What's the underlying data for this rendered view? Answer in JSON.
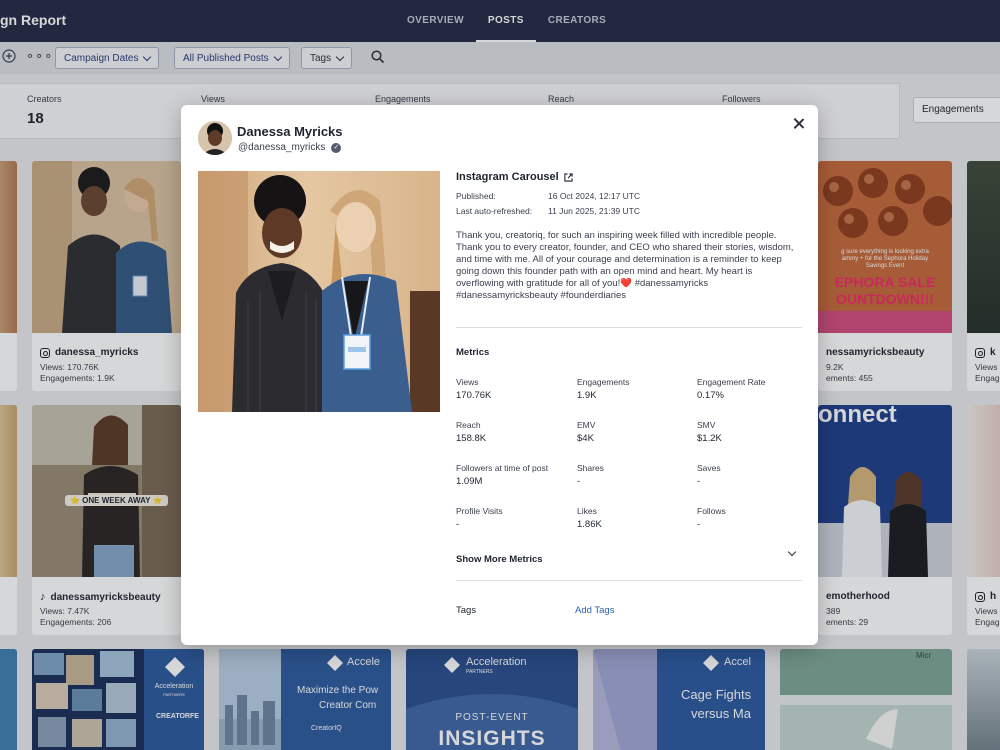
{
  "app": {
    "title": "gn Report"
  },
  "nav": {
    "tabs": [
      {
        "label": "OVERVIEW"
      },
      {
        "label": "POSTS"
      },
      {
        "label": "CREATORS"
      }
    ]
  },
  "filters": {
    "campaign_dates": "Campaign Dates",
    "published_posts": "All Published Posts",
    "tags": "Tags"
  },
  "stats": {
    "creators_label": "Creators",
    "creators_value": "18",
    "views_label": "Views",
    "engagements_label": "Engagements",
    "reach_label": "Reach",
    "followers_label": "Followers",
    "sort_value": "Engagements"
  },
  "cards": [
    {
      "handle": "danessa_myricks",
      "m1": "Views: 170.76K",
      "m2": "Engagements: 1.9K"
    },
    {
      "handle": "danessamyricksbeauty",
      "m1": "Views: 7.47K",
      "m2": "Engagements: 206"
    },
    {
      "handle": "nessamyricksbeauty",
      "m1": "9.2K",
      "m2": "ements: 455"
    },
    {
      "handle": "emotherhood",
      "m1": "389",
      "m2": "ements: 29"
    },
    {
      "handle": "k",
      "m1": "Views",
      "m2": "Engag"
    },
    {
      "handle": "h",
      "m1": "Views",
      "m2": "Engag"
    }
  ],
  "card_images": {
    "one_week_away": "⭐ ONE WEEK AWAY ⭐",
    "sephora_line1": "EPHORA SALE",
    "sephora_line2": "OUNTDOWN!!!",
    "sephora_small": "g sure everything is looking    extra",
    "sephora_small2": "ammy + for the Sephora Holiday",
    "sephora_small3": "Savings Event",
    "connect": "onnect",
    "accel1": "Acceleration",
    "accel1_sub": "PARTNERS",
    "accel1_creator": "CREATORFE",
    "accel2": "Accele",
    "accel2_line1": "Maximize the Pow",
    "accel2_line2": "Creator Com",
    "accel2_foot": "CreatorIQ",
    "accel3": "Acceleration",
    "accel3_sub": "PARTNERS",
    "accel3_line1": "POST-EVENT",
    "accel3_line2": "INSIGHTS",
    "accel4": "Accel",
    "accel4_line1": "Cage Fights",
    "accel4_line2": "versus Ma",
    "micro": "Micr"
  },
  "modal": {
    "name": "Danessa Myricks",
    "handle": "@danessa_myricks",
    "post_type": "Instagram Carousel",
    "published_label": "Published:",
    "published_value": "16 Oct 2024, 12:17 UTC",
    "refreshed_label": "Last auto-refreshed:",
    "refreshed_value": "11 Jun 2025, 21:39 UTC",
    "caption": "Thank you, creatoriq, for such an inspiring week filled with incredible people. Thank you to every creator, founder, and CEO who shared their stories, wisdom, and time with me. All of your courage and determination is a reminder to keep going down this founder path with an open mind and heart. My heart is overflowing with gratitude for all of you!❤️ #danessamyricks #danessamyricksbeauty #founderdiaries",
    "metrics_title": "Metrics",
    "metrics": [
      {
        "label": "Views",
        "value": "170.76K"
      },
      {
        "label": "Engagements",
        "value": "1.9K"
      },
      {
        "label": "Engagement Rate",
        "value": "0.17%"
      },
      {
        "label": "Reach",
        "value": "158.8K"
      },
      {
        "label": "EMV",
        "value": "$4K"
      },
      {
        "label": "SMV",
        "value": "$1.2K"
      },
      {
        "label": "Followers at time of post",
        "value": "1.09M"
      },
      {
        "label": "Shares",
        "value": "-"
      },
      {
        "label": "Saves",
        "value": "-"
      },
      {
        "label": "Profile Visits",
        "value": "-"
      },
      {
        "label": "Likes",
        "value": "1.86K"
      },
      {
        "label": "Follows",
        "value": "-"
      }
    ],
    "show_more": "Show More Metrics",
    "tags_label": "Tags",
    "add_tags": "Add Tags"
  },
  "colors": {
    "navy": "#232a45",
    "link": "#2b5fb4",
    "accent_blue": "#2c3d7d"
  }
}
